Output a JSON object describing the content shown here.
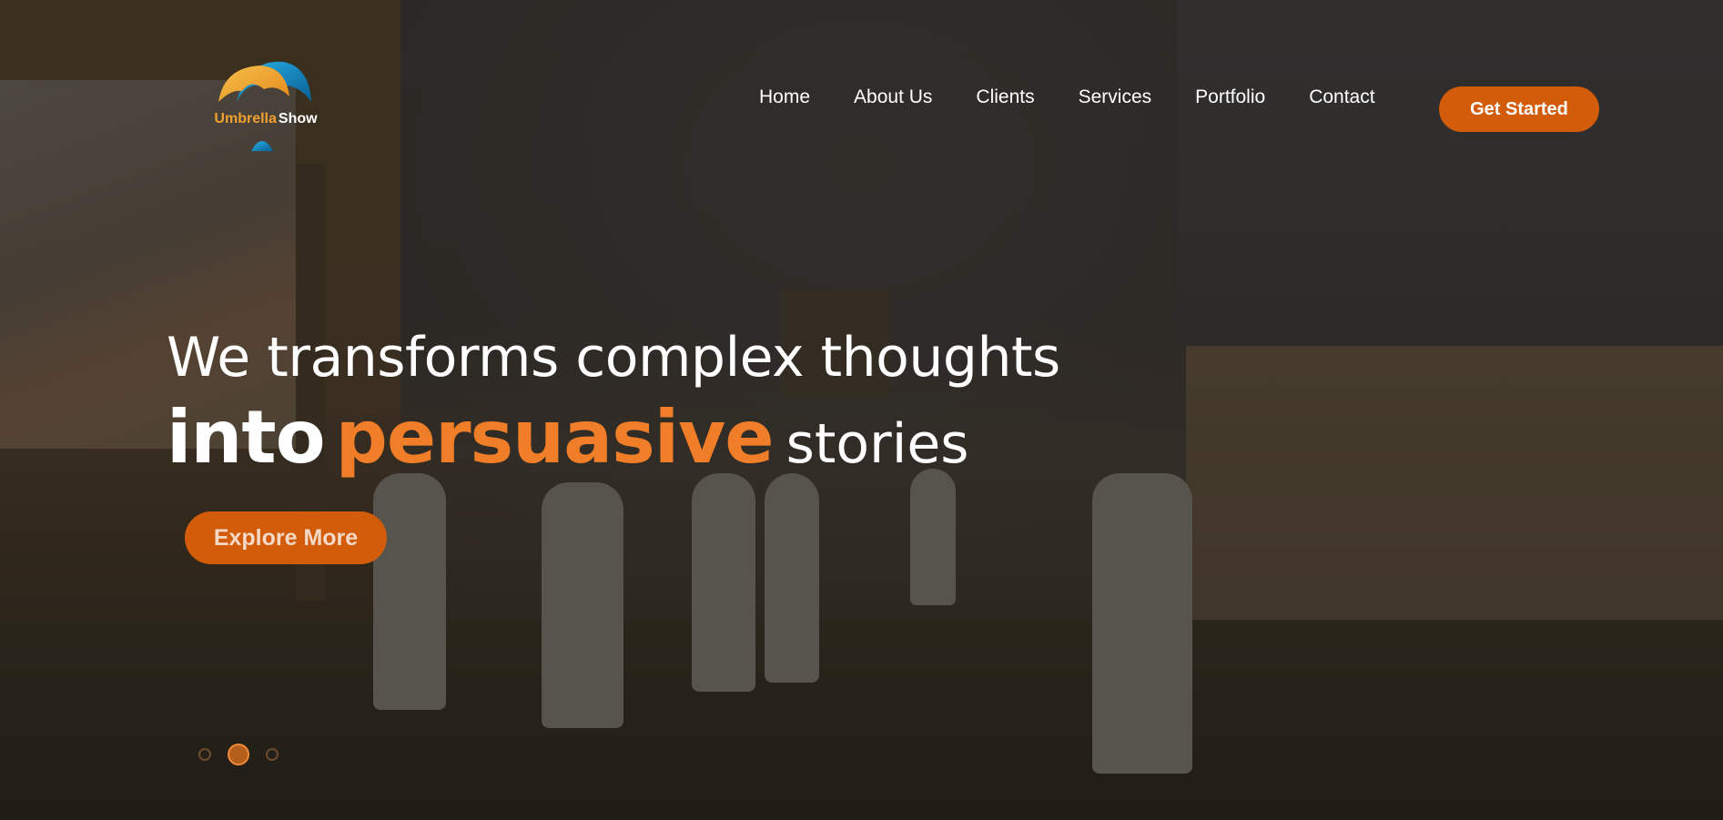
{
  "brand": {
    "part1": "Umbrella",
    "part2": "Show",
    "colors": {
      "orange": "#f0a030",
      "blue": "#1a8cc4",
      "accent": "#d35c0a"
    }
  },
  "nav": {
    "items": [
      {
        "label": "Home"
      },
      {
        "label": "About Us"
      },
      {
        "label": "Clients"
      },
      {
        "label": "Services"
      },
      {
        "label": "Portfolio"
      },
      {
        "label": "Contact"
      }
    ],
    "cta_label": "Get Started"
  },
  "hero": {
    "line1": "We transforms complex thoughts",
    "line2_part1": "into",
    "line2_accent": "persuasive",
    "line2_part2": "stories",
    "button_label": "Explore More",
    "accent_color": "#f07d27",
    "slides": {
      "count": 3,
      "active_index": 1
    }
  }
}
